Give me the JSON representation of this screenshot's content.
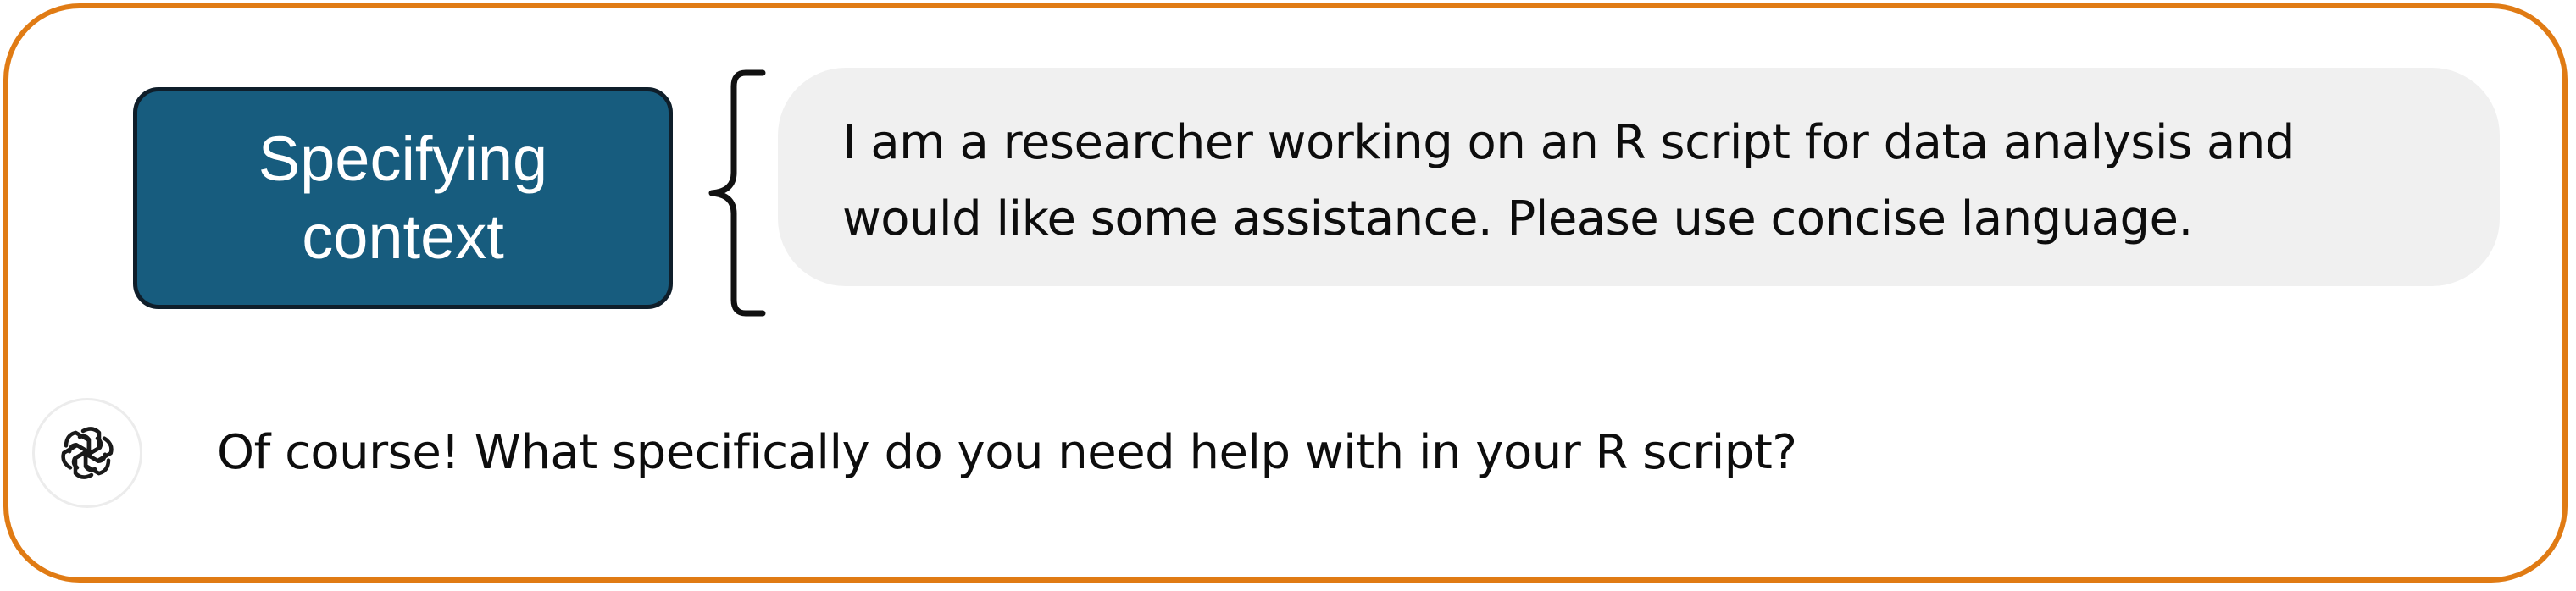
{
  "colors": {
    "frame_border": "#e07b14",
    "context_box_fill": "#175c7e",
    "context_box_border": "#0f1e2a",
    "user_bubble_bg": "#f0f0f0",
    "text": "#0d0d0d"
  },
  "annotation": {
    "label_line1": "Specifying",
    "label_line2": "context"
  },
  "conversation": {
    "user_message": {
      "text": "I am a researcher working on an R script for data analysis and would like some assistance. Please use concise language."
    },
    "assistant_message": {
      "avatar_icon": "chatgpt-logo-icon",
      "text": "Of course! What specifically do you need help with in your R script?"
    }
  }
}
